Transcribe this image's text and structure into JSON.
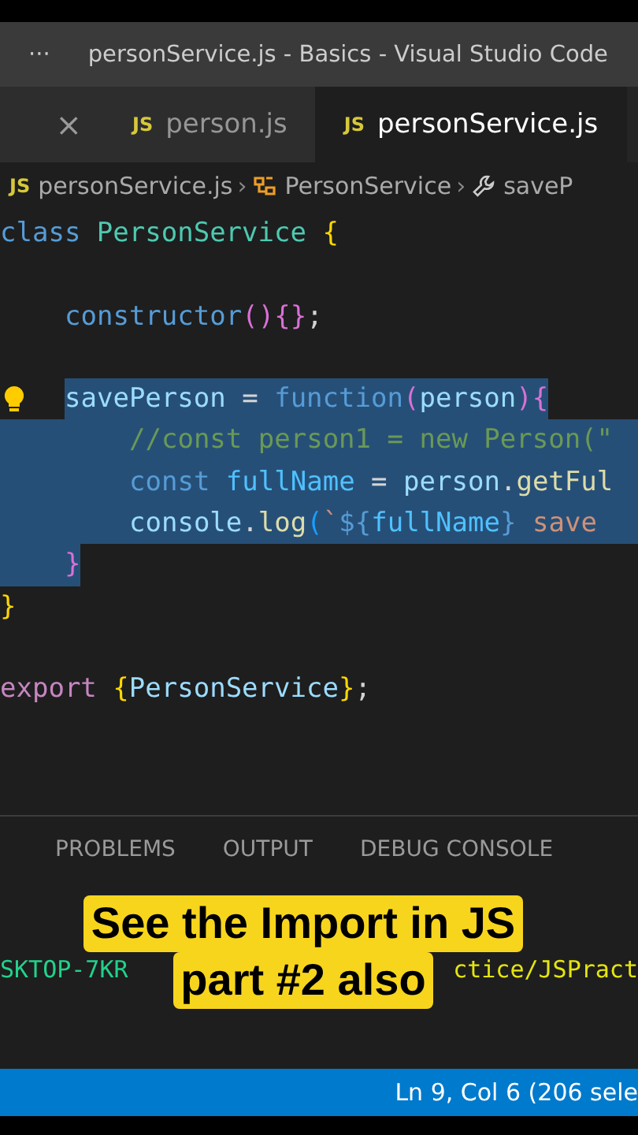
{
  "title_bar": {
    "menu": "···",
    "title": "personService.js - Basics - Visual Studio Code"
  },
  "tabs": [
    {
      "kind": "close",
      "label": "×",
      "selected": false
    },
    {
      "kind": "file",
      "icon": "JS",
      "label": "person.js",
      "selected": false
    },
    {
      "kind": "file",
      "icon": "JS",
      "label": "personService.js",
      "selected": true
    }
  ],
  "breadcrumb": [
    {
      "kind": "file",
      "icon": "JS",
      "label": "personService.js"
    },
    {
      "kind": "class",
      "separator": "›",
      "label": "PersonService"
    },
    {
      "kind": "method",
      "separator": "›",
      "label": "saveP"
    }
  ],
  "code_lines": [
    {
      "kind": "top",
      "selected": false,
      "tokens": [
        {
          "text": "class ",
          "kind": "keyword"
        },
        {
          "text": "PersonService ",
          "kind": "type"
        },
        {
          "text": "{",
          "kind": "bracket1"
        }
      ]
    },
    {
      "kind": "blank"
    },
    {
      "kind": "member",
      "selected": false,
      "tokens": [
        {
          "text": "constructor",
          "kind": "keyword"
        },
        {
          "text": "()",
          "kind": "bracket2"
        },
        {
          "text": "{}",
          "kind": "bracket2"
        },
        {
          "text": ";",
          "kind": "plain"
        }
      ]
    },
    {
      "kind": "blank"
    },
    {
      "kind": "member",
      "selected": true,
      "lightbulb": true,
      "tokens": [
        {
          "text": "savePerson",
          "kind": "variable"
        },
        {
          "text": " = ",
          "kind": "plain"
        },
        {
          "text": "function",
          "kind": "keyword"
        },
        {
          "text": "(",
          "kind": "bracket2"
        },
        {
          "text": "person",
          "kind": "variable"
        },
        {
          "text": ")",
          "kind": "bracket2"
        },
        {
          "text": "{",
          "kind": "bracket2"
        }
      ]
    },
    {
      "kind": "body",
      "selected": true,
      "tokens": [
        {
          "text": "//const person1 = new Person(\"",
          "kind": "comment"
        }
      ]
    },
    {
      "kind": "body",
      "selected": true,
      "tokens": [
        {
          "text": "const ",
          "kind": "keyword"
        },
        {
          "text": "fullName",
          "kind": "constant"
        },
        {
          "text": " = ",
          "kind": "plain"
        },
        {
          "text": "person",
          "kind": "variable"
        },
        {
          "text": ".",
          "kind": "plain"
        },
        {
          "text": "getFul",
          "kind": "function"
        }
      ]
    },
    {
      "kind": "body",
      "selected": true,
      "tokens": [
        {
          "text": "console",
          "kind": "variable"
        },
        {
          "text": ".",
          "kind": "plain"
        },
        {
          "text": "log",
          "kind": "function"
        },
        {
          "text": "(",
          "kind": "bracket3"
        },
        {
          "text": "`",
          "kind": "string"
        },
        {
          "text": "${",
          "kind": "keyword"
        },
        {
          "text": "fullName",
          "kind": "constant"
        },
        {
          "text": "}",
          "kind": "keyword"
        },
        {
          "text": " save",
          "kind": "string"
        }
      ]
    },
    {
      "kind": "closing",
      "selected": true,
      "tokens": [
        {
          "text": "}",
          "kind": "bracket2"
        }
      ]
    },
    {
      "kind": "top",
      "selected": false,
      "tokens": [
        {
          "text": "}",
          "kind": "bracket1"
        }
      ]
    },
    {
      "kind": "blank"
    },
    {
      "kind": "top",
      "selected": false,
      "tokens": [
        {
          "text": "export ",
          "kind": "control"
        },
        {
          "text": "{",
          "kind": "bracket1"
        },
        {
          "text": "PersonService",
          "kind": "variable"
        },
        {
          "text": "}",
          "kind": "bracket1"
        },
        {
          "text": ";",
          "kind": "plain"
        }
      ]
    }
  ],
  "panel_tabs": [
    {
      "label": "PROBLEMS",
      "selected": false
    },
    {
      "label": "OUTPUT",
      "selected": false
    },
    {
      "label": "DEBUG CONSOLE",
      "selected": false
    }
  ],
  "terminal": {
    "host": "SKTOP-7KR",
    "path": "ctice/JSPract"
  },
  "caption": {
    "lines": [
      "See the Import in JS",
      "part #2 also"
    ]
  },
  "status_bar": {
    "position": "Ln 9, Col 6 (206 sele"
  }
}
